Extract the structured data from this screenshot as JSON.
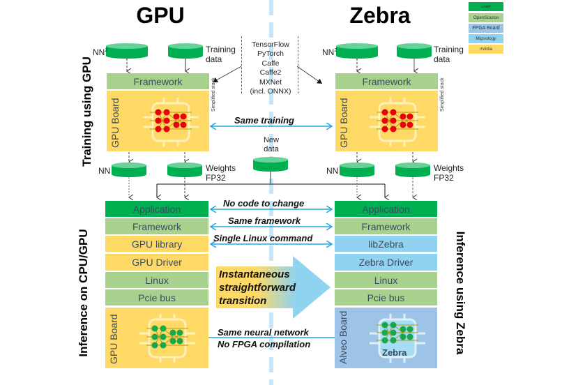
{
  "titles": {
    "left": "GPU",
    "right": "Zebra"
  },
  "side_labels": {
    "training": "Training using GPU",
    "inference_gpu": "Inference on CPU/GPU",
    "inference_zebra": "Inference using Zebra"
  },
  "legend": [
    {
      "label": "User",
      "color": "#00b050"
    },
    {
      "label": "OpenSource",
      "color": "#a9d18e"
    },
    {
      "label": "FPGA Board",
      "color": "#9dc3e6"
    },
    {
      "label": "Mipsology",
      "color": "#8fd3f0"
    },
    {
      "label": "nVidia",
      "color": "#ffd966"
    }
  ],
  "frameworks_list": [
    "TensorFlow",
    "PyTorch",
    "Caffe",
    "Caffe2",
    "MXNet",
    "(incl. ONNX)"
  ],
  "training": {
    "left": {
      "db_nn": "NN",
      "db_nn_sup": "2",
      "db_training": "Training data",
      "framework": "Framework",
      "board": "GPU Board",
      "simplified": "Simplified stack",
      "db_out_nn": "NN",
      "db_out_weights": "Weights FP32"
    },
    "right": {
      "db_nn": "NN",
      "db_nn_sup": "2",
      "db_training": "Training data",
      "framework": "Framework",
      "board": "GPU Board",
      "simplified": "Simplified stack",
      "db_out_nn": "NN",
      "db_out_weights": "Weights FP32"
    },
    "same_training": "Same training",
    "new_data": "New data"
  },
  "inference": {
    "left_stack": [
      {
        "label": "Application",
        "kind": "User"
      },
      {
        "label": "Framework",
        "kind": "OpenSource"
      },
      {
        "label": "GPU library",
        "kind": "nVidia"
      },
      {
        "label": "GPU Driver",
        "kind": "nVidia"
      },
      {
        "label": "Linux",
        "kind": "OpenSource"
      },
      {
        "label": "Pcie bus",
        "kind": "OpenSource"
      }
    ],
    "right_stack": [
      {
        "label": "Application",
        "kind": "User"
      },
      {
        "label": "Framework",
        "kind": "OpenSource"
      },
      {
        "label": "libZebra",
        "kind": "Mipsology"
      },
      {
        "label": "Zebra Driver",
        "kind": "Mipsology"
      },
      {
        "label": "Linux",
        "kind": "OpenSource"
      },
      {
        "label": "Pcie bus",
        "kind": "OpenSource"
      }
    ],
    "left_board": "GPU Board",
    "right_board": "Alveo Board",
    "chip_label": "Zebra",
    "arrows": {
      "no_code": "No code to change",
      "same_framework": "Same framework",
      "single_linux": "Single Linux command",
      "same_nn_line1": "Same neural network",
      "same_nn_line2": "No FPGA compilation"
    },
    "transition": [
      "Instantaneous",
      "straightforward",
      "transition"
    ]
  }
}
